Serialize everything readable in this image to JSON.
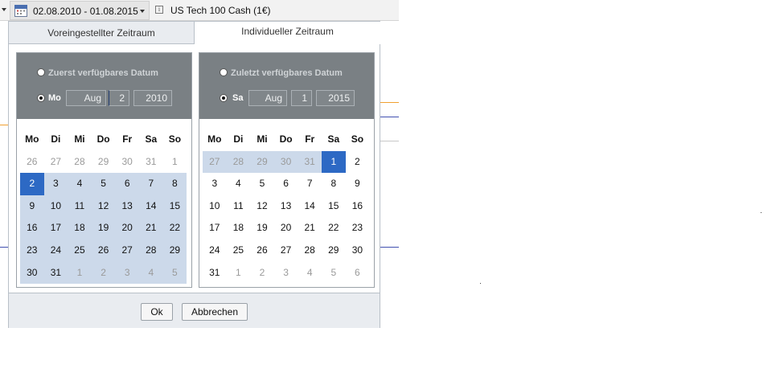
{
  "toolbar": {
    "date_range": "02.08.2010 - 01.08.2015",
    "symbol": "US Tech 100 Cash (1€)"
  },
  "dialog": {
    "tabs": [
      "Voreingestellter Zeitraum",
      "Individueller Zeitraum"
    ],
    "active_tab": "Individueller Zeitraum",
    "start": {
      "option_label": "Zuerst verfügbares Datum",
      "date_label": "Mo",
      "month": "Aug",
      "day": "2",
      "year": "2010",
      "weekday_headers": [
        "Mo",
        "Di",
        "Mi",
        "Do",
        "Fr",
        "Sa",
        "So"
      ],
      "days": [
        [
          "26",
          "27",
          "28",
          "29",
          "30",
          "31",
          "1"
        ],
        [
          "2",
          "3",
          "4",
          "5",
          "6",
          "7",
          "8"
        ],
        [
          "9",
          "10",
          "11",
          "12",
          "13",
          "14",
          "15"
        ],
        [
          "16",
          "17",
          "18",
          "19",
          "20",
          "21",
          "22"
        ],
        [
          "23",
          "24",
          "25",
          "26",
          "27",
          "28",
          "29"
        ],
        [
          "30",
          "31",
          "1",
          "2",
          "3",
          "4",
          "5"
        ]
      ]
    },
    "end": {
      "option_label": "Zuletzt verfügbares Datum",
      "date_label": "Sa",
      "month": "Aug",
      "day": "1",
      "year": "2015",
      "weekday_headers": [
        "Mo",
        "Di",
        "Mi",
        "Do",
        "Fr",
        "Sa",
        "So"
      ],
      "days": [
        [
          "27",
          "28",
          "29",
          "30",
          "31",
          "1",
          "2"
        ],
        [
          "3",
          "4",
          "5",
          "6",
          "7",
          "8",
          "9"
        ],
        [
          "10",
          "11",
          "12",
          "13",
          "14",
          "15",
          "16"
        ],
        [
          "17",
          "18",
          "19",
          "20",
          "21",
          "22",
          "23"
        ],
        [
          "24",
          "25",
          "26",
          "27",
          "28",
          "29",
          "30"
        ],
        [
          "31",
          "1",
          "2",
          "3",
          "4",
          "5",
          "6"
        ]
      ]
    },
    "buttons": {
      "ok": "Ok",
      "cancel": "Abbrechen"
    }
  },
  "colors": {
    "selected_day": "#2d69c4",
    "range_highlight": "#ccd9ea",
    "panel_header": "#7a8084",
    "chart_line_orange": "#f0a030",
    "chart_line_blue": "#4050b0"
  }
}
